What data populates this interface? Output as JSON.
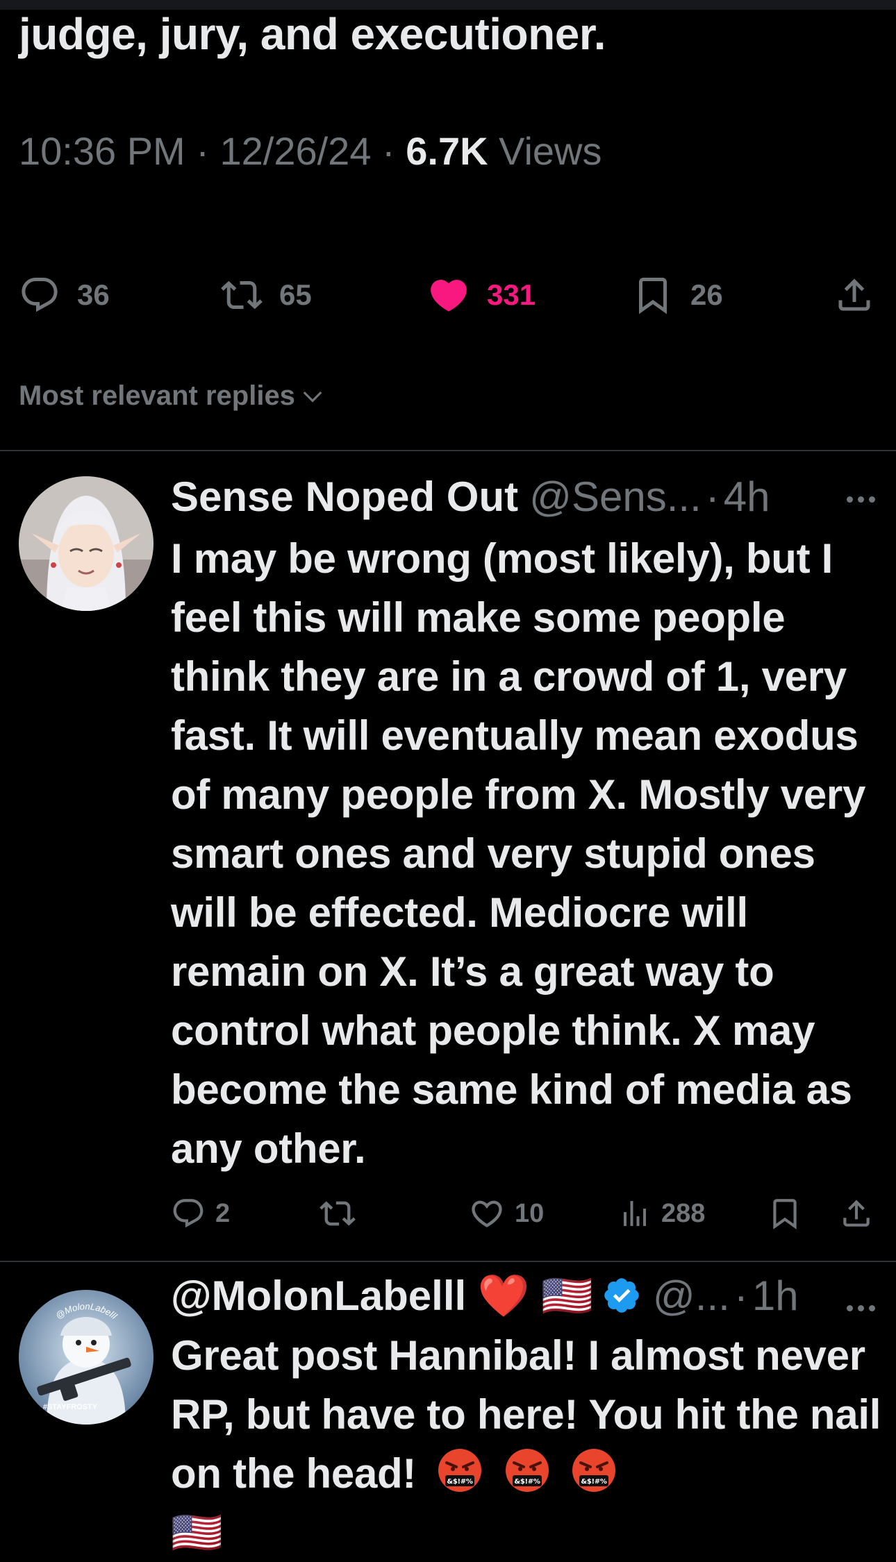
{
  "tweet": {
    "text_tail": "judge, jury, and executioner.",
    "time": "10:36 PM",
    "date": "12/26/24",
    "views_count": "6.7K",
    "views_label": "Views",
    "separator": "·",
    "actions": {
      "replies": "36",
      "reposts": "65",
      "likes": "331",
      "bookmarks": "26"
    },
    "liked": true,
    "like_color": "#f91880"
  },
  "replies_sort": {
    "label": "Most relevant replies"
  },
  "replies": [
    {
      "name": "Sense Noped Out",
      "handle": "@Sens...",
      "time": "4h",
      "separator": "·",
      "avatar_icon": "anime-elf-avatar",
      "text": "I may be wrong (most likely), but I feel this will make some people think they are in a crowd of 1, very fast. It will eventually mean exodus of many people from X. Mostly very smart ones and very stupid ones will be effected. Mediocre will remain on X. It’s a great way to control what people think. X may become the same kind of media as any other.",
      "actions": {
        "replies": "2",
        "reposts": "",
        "likes": "10",
        "views": "288"
      }
    },
    {
      "name": "@MolonLabelll ❤️ 🇺🇸",
      "verified": true,
      "verified_color": "#1d9bf0",
      "handle": "@...",
      "time": "1h",
      "separator": "·",
      "avatar_icon": "snowman-soldier-avatar",
      "avatar_text_top": "@MolonLabelll",
      "avatar_text_bottom": "#STAYFROSTY",
      "text": "Great post Hannibal! I almost never RP, but have to here! You hit the nail on the head!",
      "emoji_label": "&$!#%",
      "trailing_flag": "🇺🇸"
    }
  ]
}
